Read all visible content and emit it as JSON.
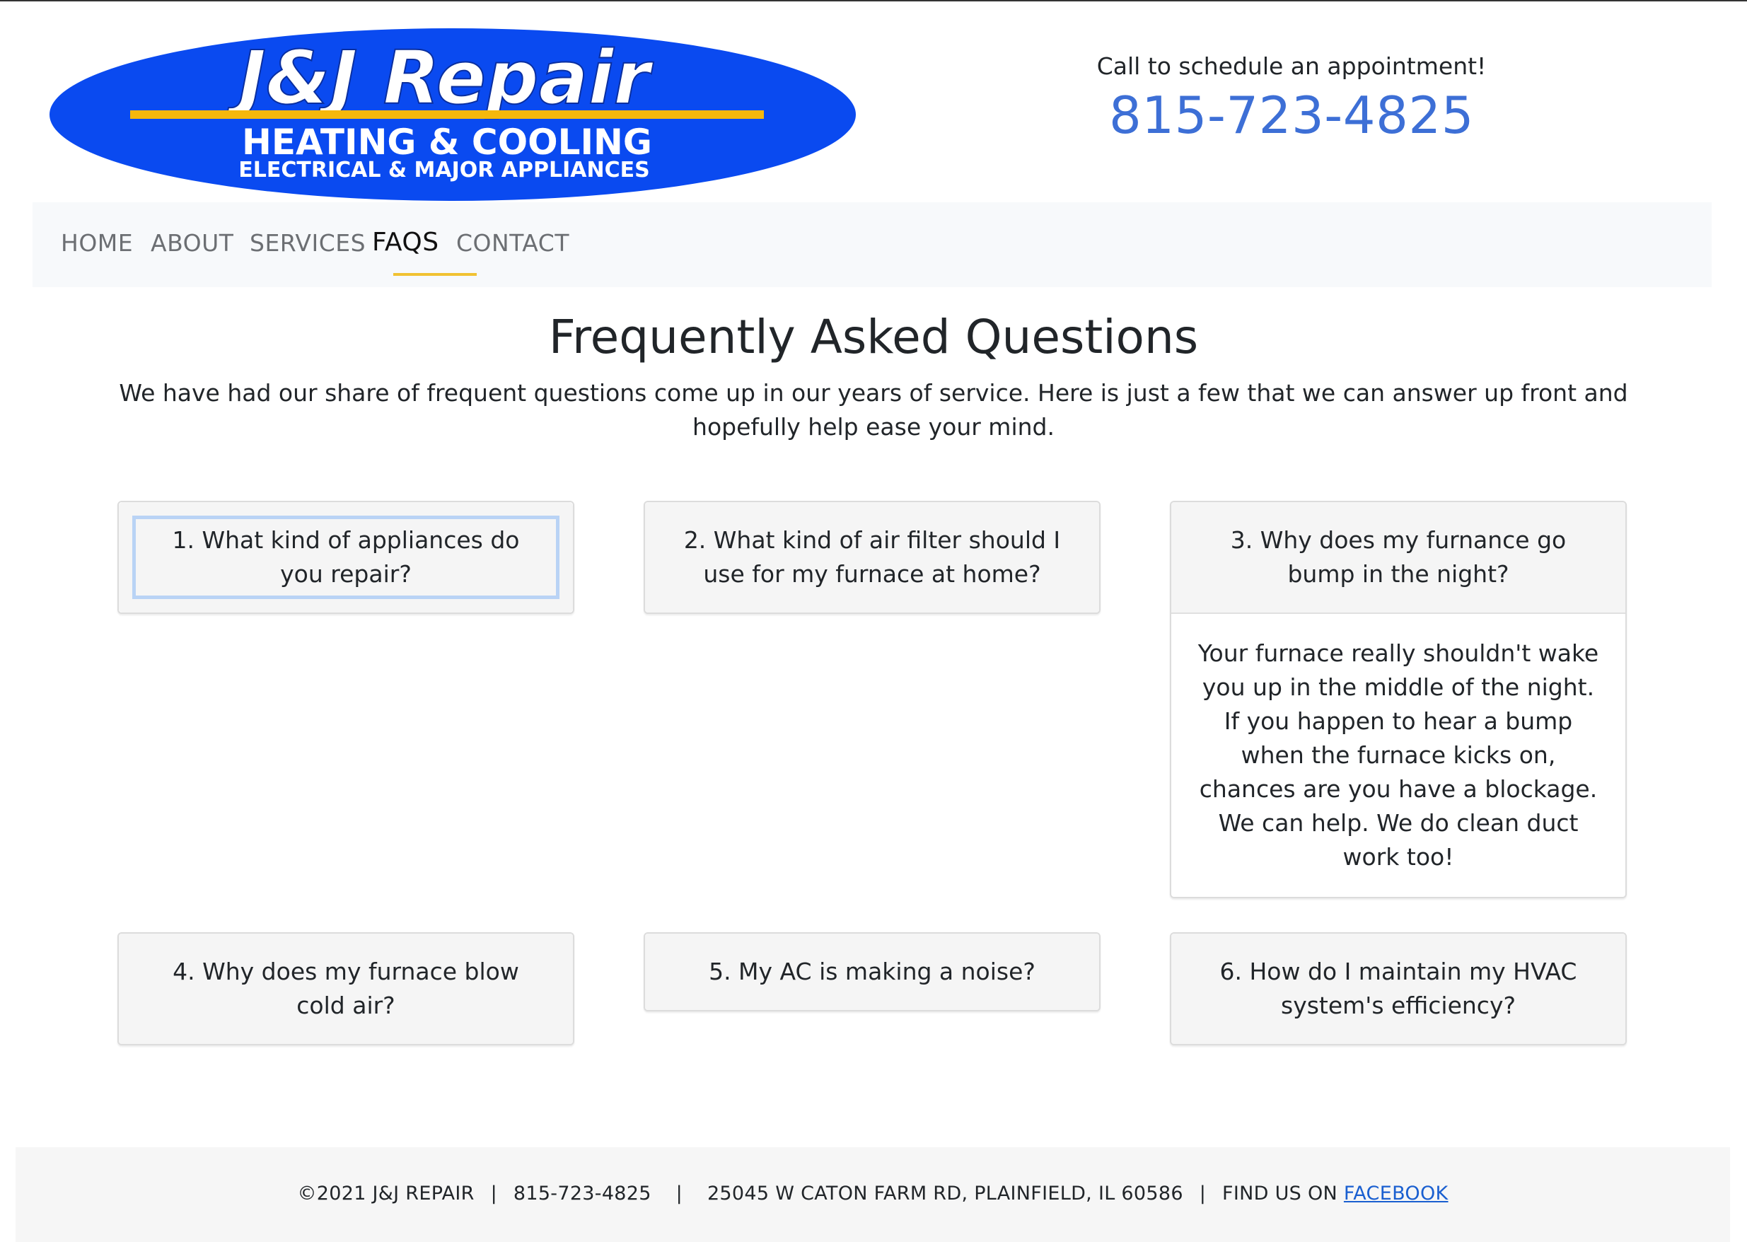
{
  "logo": {
    "line1": "J&J Repair",
    "line2": "HEATING & COOLING",
    "line3": "ELECTRICAL & MAJOR APPLIANCES",
    "colors": {
      "ellipse": "#0a4af0",
      "stripe": "#f5b80b",
      "text": "#ffffff"
    }
  },
  "cta": {
    "text": "Call to schedule an appointment!",
    "phone": "815-723-4825"
  },
  "nav": {
    "items": [
      {
        "label": "HOME"
      },
      {
        "label": "ABOUT"
      },
      {
        "label": "SERVICES"
      },
      {
        "label": "FAQS",
        "active": true
      },
      {
        "label": "CONTACT"
      }
    ]
  },
  "main": {
    "title": "Frequently Asked Questions",
    "intro": "We have had our share of frequent questions come up in our years of service. Here is just a few that we can answer up front and hopefully help ease your mind."
  },
  "faqs": [
    {
      "question": "1. What kind of appliances do you repair?"
    },
    {
      "question": "2. What kind of air filter should I use for my furnace at home?"
    },
    {
      "question": "3. Why does my furnance go bump in the night?",
      "answer": "Your furnace really shouldn't wake you up in the middle of the night. If you happen to hear a bump when the furnace kicks on, chances are you have a blockage. We can help. We do clean duct work too!"
    },
    {
      "question": "4. Why does my furnace blow cold air?"
    },
    {
      "question": "5. My AC is making a noise?"
    },
    {
      "question": "6. How do I maintain my HVAC system's efficiency?"
    }
  ],
  "footer": {
    "copyright": "©2021 J&J REPAIR",
    "divider": "|",
    "phone": "815-723-4825",
    "address": "25045 W CATON FARM RD, PLAINFIELD, IL 60586",
    "find_us": "FIND US ON",
    "facebook": "FACEBOOK"
  },
  "colors": {
    "accent": "#3d6fd6",
    "underline": "#f1c232",
    "link": "#1a5fd0"
  }
}
